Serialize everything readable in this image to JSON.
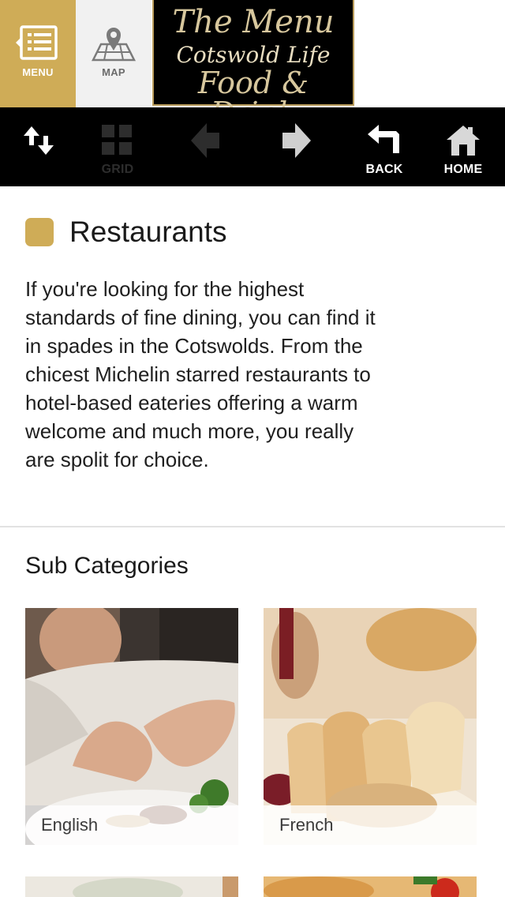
{
  "header": {
    "tabs": [
      {
        "label": "MENU",
        "icon": "list-icon",
        "active": true
      },
      {
        "label": "MAP",
        "icon": "map-pin-icon",
        "active": false
      }
    ],
    "logo": {
      "line1": "The Menu",
      "line2": "Cotswold Life",
      "line3": "Food & Drink"
    }
  },
  "toolbar": {
    "items": [
      {
        "name": "sort",
        "icon": "sort-arrows-icon",
        "label": ""
      },
      {
        "name": "grid",
        "icon": "grid-icon",
        "label": "GRID"
      },
      {
        "name": "previous",
        "icon": "arrow-left-icon",
        "label": ""
      },
      {
        "name": "next",
        "icon": "arrow-right-icon",
        "label": ""
      },
      {
        "name": "back",
        "icon": "back-arrow-icon",
        "label": "BACK"
      },
      {
        "name": "home",
        "icon": "home-icon",
        "label": "HOME"
      }
    ]
  },
  "category": {
    "title": "Restaurants",
    "accent_color": "#cfac57",
    "description": "If you're looking for the highest standards of fine dining, you can find it in spades in the Cotswolds. From the chicest Michelin starred restaurants to hotel-based eateries offering a warm welcome and much more, you really are spolit for choice."
  },
  "sub_categories": {
    "title": "Sub Categories",
    "items": [
      {
        "label": "English"
      },
      {
        "label": "French"
      }
    ]
  }
}
